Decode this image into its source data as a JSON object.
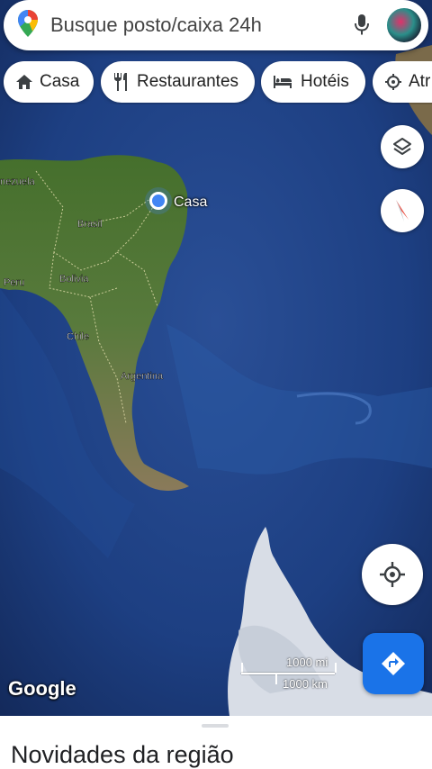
{
  "search": {
    "placeholder": "Busque posto/caixa 24h",
    "mic_icon": "mic-icon",
    "avatar_icon": "profile-avatar"
  },
  "chips": [
    {
      "label": "Casa",
      "icon": "home-icon"
    },
    {
      "label": "Restaurantes",
      "icon": "restaurant-icon"
    },
    {
      "label": "Hotéis",
      "icon": "hotel-icon"
    },
    {
      "label": "Atr",
      "icon": "attraction-icon"
    }
  ],
  "map": {
    "home_marker_label": "Casa",
    "labels": [
      "nezuela",
      "Brasil",
      "Peru",
      "Bolivia",
      "Chile",
      "Argentina"
    ],
    "attribution": "Google",
    "scale": {
      "miles": "1000 mi",
      "km": "1000 km"
    }
  },
  "controls": {
    "layers_icon": "layers-icon",
    "compass_icon": "compass-icon",
    "location_icon": "my-location-icon",
    "directions_icon": "directions-icon"
  },
  "sheet": {
    "title": "Novidades da região"
  },
  "colors": {
    "accent": "#1a73e8",
    "ocean": "#1c3a72",
    "land": "#3f6b2e"
  }
}
